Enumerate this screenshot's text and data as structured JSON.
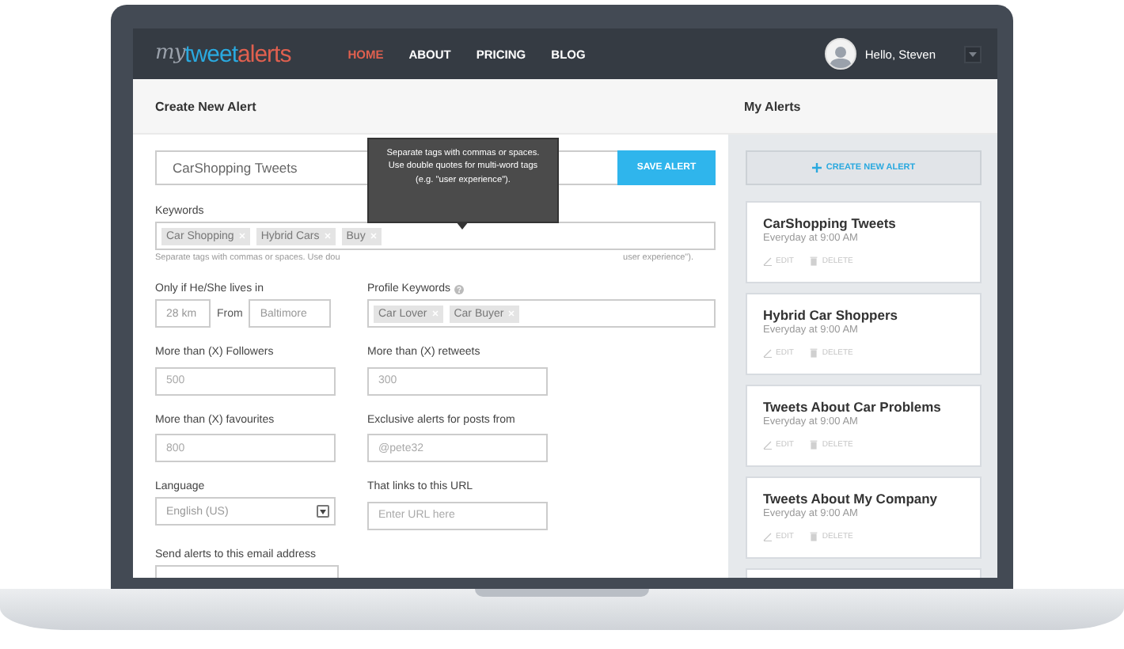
{
  "logo": {
    "parts": [
      {
        "text": "my",
        "color": "#9aa1ab"
      },
      {
        "text": "tweet",
        "color": "#2aa9df"
      },
      {
        "text": "alerts",
        "color": "#e0604f"
      }
    ]
  },
  "nav": [
    {
      "label": "HOME",
      "selected": true
    },
    {
      "label": "ABOUT",
      "selected": false
    },
    {
      "label": "PRICING",
      "selected": false
    },
    {
      "label": "BLOG",
      "selected": false
    }
  ],
  "user": {
    "greeting": "Hello, Steven"
  },
  "create_alert": {
    "title": "Create New Alert",
    "name_value": "CarShopping Tweets",
    "save_button": "SAVE ALERT",
    "keywords": {
      "label": "Keywords",
      "tags": [
        "Car Shopping",
        "Hybrid Cars",
        "Buy"
      ],
      "hint_start": "Separate tags with commas or spaces. Use dou",
      "hint_end": "user experience\")."
    },
    "tooltip": {
      "lines": [
        "Separate tags with commas or spaces. Use double quotes for multi-word tags",
        "(e.g. \"user experience\")."
      ]
    },
    "location": {
      "label": "Only if He/She lives in",
      "distance": "28 km",
      "from_label": "From",
      "city": "Baltimore"
    },
    "profile_keywords": {
      "label": "Profile Keywords",
      "tags": [
        "Car Lover",
        "Car Buyer"
      ]
    },
    "fields": [
      {
        "kind": "text",
        "label": "More than (X) Followers",
        "placeholder": "500"
      },
      {
        "kind": "text",
        "label": "More than (X) retweets",
        "placeholder": "300"
      },
      {
        "kind": "text",
        "label": "More than (X) favourites",
        "placeholder": "800"
      },
      {
        "kind": "text",
        "label": "Exclusive alerts for posts from",
        "placeholder": "@pete32"
      },
      {
        "kind": "select",
        "label": "Language",
        "value": "English (US)"
      },
      {
        "kind": "text",
        "label": "That links to this URL",
        "placeholder": "Enter URL here"
      }
    ],
    "email_label": "Send alerts to this email address"
  },
  "my_alerts": {
    "title": "My Alerts",
    "create_button": "CREATE NEW ALERT",
    "alerts": [
      {
        "name": "CarShopping Tweets",
        "schedule": "Everyday at 9:00 AM",
        "edit": "EDIT",
        "delete": "DELETE"
      },
      {
        "name": "Hybrid Car Shoppers",
        "schedule": "Everyday at 9:00 AM",
        "edit": "EDIT",
        "delete": "DELETE"
      },
      {
        "name": "Tweets About Car Problems",
        "schedule": "Everyday at 9:00 AM",
        "edit": "EDIT",
        "delete": "DELETE"
      },
      {
        "name": "Tweets About My Company",
        "schedule": "Everyday at 9:00 AM",
        "edit": "EDIT",
        "delete": "DELETE"
      }
    ]
  }
}
